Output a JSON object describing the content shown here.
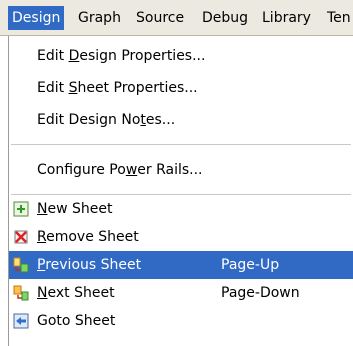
{
  "menubar": {
    "items": [
      {
        "label": "Design"
      },
      {
        "label": "Graph"
      },
      {
        "label": "Source"
      },
      {
        "label": "Debug"
      },
      {
        "label": "Library"
      },
      {
        "label": "Ten"
      }
    ]
  },
  "menu": {
    "items": [
      {
        "pre": "Edit ",
        "mn": "D",
        "post": "esign Properties..."
      },
      {
        "pre": "Edit ",
        "mn": "S",
        "post": "heet Properties..."
      },
      {
        "pre": "Edit Design No",
        "mn": "t",
        "post": "es..."
      },
      {
        "pre": "Configure Po",
        "mn": "w",
        "post": "er Rails..."
      },
      {
        "pre": "",
        "mn": "N",
        "post": "ew Sheet",
        "icon": "new-sheet-icon"
      },
      {
        "pre": "",
        "mn": "R",
        "post": "emove Sheet",
        "icon": "remove-sheet-icon"
      },
      {
        "pre": "",
        "mn": "P",
        "post": "revious Sheet",
        "shortcut": "Page-Up",
        "icon": "previous-sheet-icon"
      },
      {
        "pre": "",
        "mn": "N",
        "post": "ext Sheet",
        "shortcut": "Page-Down",
        "icon": "next-sheet-icon"
      },
      {
        "pre": "Goto Sheet",
        "mn": "",
        "post": "",
        "icon": "goto-sheet-icon"
      }
    ]
  },
  "colors": {
    "highlight": "#316ac5",
    "menubar_bg": "#ebe9e0"
  }
}
